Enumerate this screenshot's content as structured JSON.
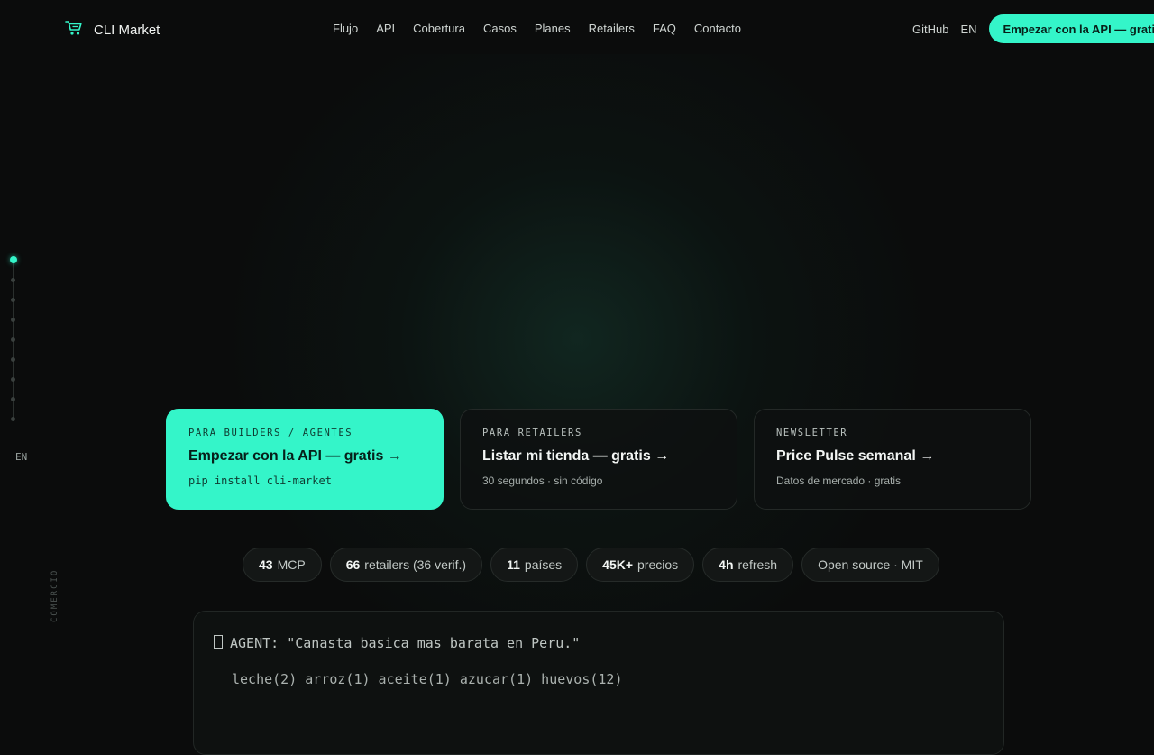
{
  "brand": {
    "name": "CLI Market",
    "icon": "cart-icon",
    "accent": "#34f5c9"
  },
  "nav": [
    {
      "label": "Flujo"
    },
    {
      "label": "API"
    },
    {
      "label": "Cobertura"
    },
    {
      "label": "Casos"
    },
    {
      "label": "Planes"
    },
    {
      "label": "Retailers"
    },
    {
      "label": "FAQ"
    },
    {
      "label": "Contacto"
    }
  ],
  "header_right": {
    "github": "GitHub",
    "lang": "EN",
    "cta": "Empezar con la API — gratis →"
  },
  "rail": {
    "lang": "EN",
    "vertical_label": "COMERCIO"
  },
  "cards": [
    {
      "eyebrow": "PARA BUILDERS / AGENTES",
      "title": "Empezar con la API — gratis →",
      "sub": "pip install cli-market"
    },
    {
      "eyebrow": "PARA RETAILERS",
      "title": "Listar mi tienda — gratis →",
      "sub": "30 segundos · sin código"
    },
    {
      "eyebrow": "NEWSLETTER",
      "title": "Price Pulse semanal →",
      "sub": "Datos de mercado · gratis"
    }
  ],
  "stats": [
    {
      "value": "43",
      "label": "MCP"
    },
    {
      "value": "66",
      "label": "retailers (36 verif.)"
    },
    {
      "value": "11",
      "label": "países"
    },
    {
      "value": "45K+",
      "label": "precios"
    },
    {
      "value": "4h",
      "label": "refresh"
    },
    {
      "value": "",
      "label": "Open source · MIT"
    }
  ],
  "terminal": {
    "line1": "AGENT: \"Canasta basica mas barata en Peru.\"",
    "line2": "leche(2) arroz(1) aceite(1) azucar(1) huevos(12)"
  }
}
